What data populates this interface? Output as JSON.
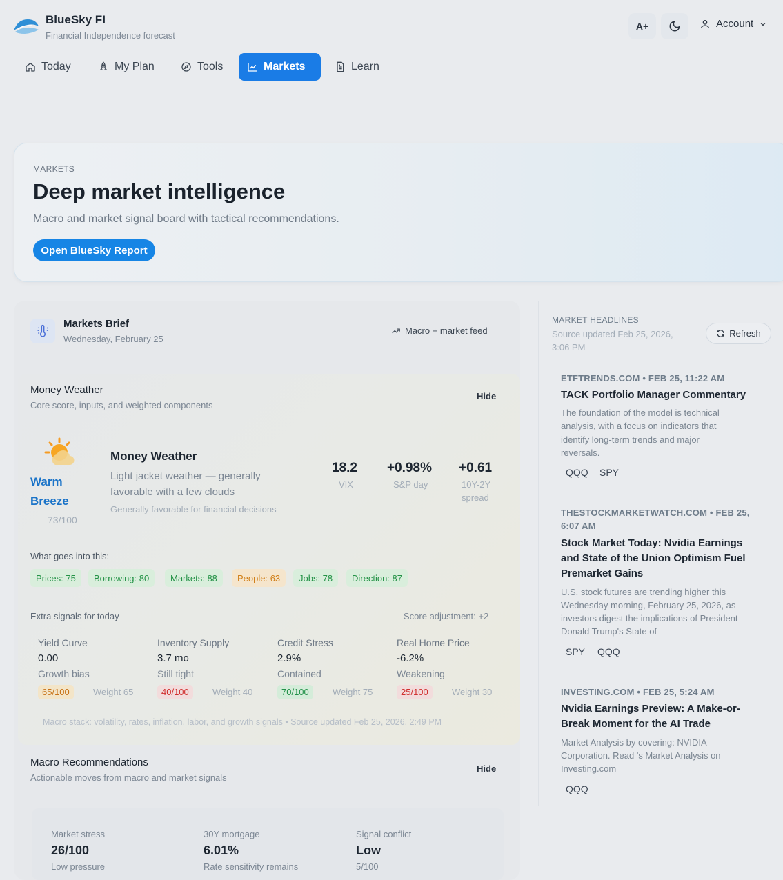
{
  "app": {
    "name": "BlueSky FI",
    "tagline": "Financial Independence forecast"
  },
  "header": {
    "font_button": "A+",
    "account_label": "Account"
  },
  "nav": [
    {
      "label": "Today",
      "icon": "home-icon"
    },
    {
      "label": "My Plan",
      "icon": "rocket-icon"
    },
    {
      "label": "Tools",
      "icon": "compass-icon"
    },
    {
      "label": "Markets",
      "icon": "chart-icon",
      "active": true
    },
    {
      "label": "Learn",
      "icon": "document-icon"
    }
  ],
  "hero": {
    "eyebrow": "MARKETS",
    "title": "Deep market intelligence",
    "subtitle": "Macro and market signal board with tactical recommendations.",
    "cta": "Open BlueSky Report"
  },
  "brief": {
    "title": "Markets Brief",
    "date": "Wednesday, February 25",
    "feed": "Macro + market feed"
  },
  "money_weather": {
    "title": "Money Weather",
    "subtitle": "Core score, inputs, and weighted components",
    "hide": "Hide",
    "status_line1": "Warm",
    "status_line2": "Breeze",
    "score": "73/100",
    "headline": "Money Weather",
    "desc_line1": "Light jacket weather — generally",
    "desc_line2": "favorable with a few clouds",
    "note": "Generally favorable for financial decisions",
    "stats": [
      {
        "value": "18.2",
        "label": "VIX",
        "label2": ""
      },
      {
        "value": "+0.98%",
        "label": "S&P day",
        "label2": ""
      },
      {
        "value": "+0.61",
        "label": "10Y-2Y",
        "label2": "spread"
      }
    ],
    "inputs_label": "What goes into this:",
    "inputs": [
      {
        "label": "Prices: 75",
        "tone": "good"
      },
      {
        "label": "Borrowing: 80",
        "tone": "good"
      },
      {
        "label": "Markets: 88",
        "tone": "good"
      },
      {
        "label": "People: 63",
        "tone": "warn"
      },
      {
        "label": "Jobs: 78",
        "tone": "good"
      },
      {
        "label": "Direction: 87",
        "tone": "good"
      }
    ],
    "extra_label": "Extra signals for today",
    "adjustment": "Score adjustment: +2",
    "signals": [
      {
        "name": "Yield Curve",
        "value": "0.00",
        "status": "Growth bias",
        "score": "65/100",
        "weight": "Weight 65",
        "tone": "warn"
      },
      {
        "name": "Inventory Supply",
        "value": "3.7 mo",
        "status": "Still tight",
        "score": "40/100",
        "weight": "Weight 40",
        "tone": "bad"
      },
      {
        "name": "Credit Stress",
        "value": "2.9%",
        "status": "Contained",
        "score": "70/100",
        "weight": "Weight 75",
        "tone": "good"
      },
      {
        "name": "Real Home Price",
        "value": "-6.2%",
        "status": "Weakening",
        "score": "25/100",
        "weight": "Weight 30",
        "tone": "bad"
      }
    ],
    "footnote": "Macro stack: volatility, rates, inflation, labor, and growth signals • Source updated Feb 25, 2026, 2:49 PM"
  },
  "macro_rec": {
    "title": "Macro Recommendations",
    "subtitle": "Actionable moves from macro and market signals",
    "hide": "Hide",
    "stats": [
      {
        "label": "Market stress",
        "value": "26/100",
        "note": "Low pressure"
      },
      {
        "label": "30Y mortgage",
        "value": "6.01%",
        "note": "Rate sensitivity remains"
      },
      {
        "label": "Signal conflict",
        "value": "Low",
        "note": "5/100"
      }
    ]
  },
  "headlines": {
    "title": "MARKET HEADLINES",
    "updated_line1": "Source updated Feb 25, 2026,",
    "updated_line2": "3:06 PM",
    "refresh": "Refresh",
    "items": [
      {
        "source_line1": "ETFTRENDS.COM • FEB 25, 11:22 AM",
        "source_line2": "",
        "title_lines": [
          "TACK Portfolio Manager Commentary"
        ],
        "body_lines": [
          "The foundation of the model is technical",
          "analysis, with a focus on indicators that",
          "identify long-term trends and major",
          "reversals."
        ],
        "tickers": [
          "QQQ",
          "SPY"
        ]
      },
      {
        "source_line1": "THESTOCKMARKETWATCH.COM • FEB 25,",
        "source_line2": "6:07 AM",
        "title_lines": [
          "Stock Market Today: Nvidia Earnings",
          "and State of the Union Optimism Fuel",
          "Premarket Gains"
        ],
        "body_lines": [
          "U.S. stock futures are trending higher this",
          "Wednesday morning, February 25, 2026, as",
          "investors digest the implications of President",
          "Donald Trump's State of"
        ],
        "tickers": [
          "SPY",
          "QQQ"
        ]
      },
      {
        "source_line1": "INVESTING.COM • FEB 25, 5:24 AM",
        "source_line2": "",
        "title_lines": [
          "Nvidia Earnings Preview: A Make-or-",
          "Break Moment for the AI Trade"
        ],
        "body_lines": [
          "Market Analysis by covering: NVIDIA",
          "Corporation. Read 's Market Analysis on",
          "Investing.com"
        ],
        "tickers": [
          "QQQ"
        ]
      }
    ]
  }
}
